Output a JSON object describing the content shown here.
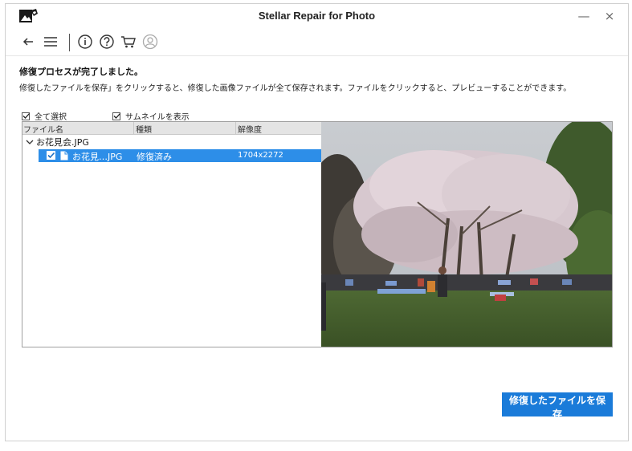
{
  "window": {
    "title": "Stellar Repair for Photo",
    "minimize_glyph": "—",
    "close_glyph": "×"
  },
  "toolbar": {
    "icons": [
      "back-arrow-icon",
      "menu-icon",
      "info-icon",
      "help-icon",
      "cart-icon",
      "account-icon"
    ]
  },
  "content": {
    "heading": "修復プロセスが完了しました。",
    "description": "修復したファイルを保存」をクリックすると、修復した画像ファイルが全て保存されます。ファイルをクリックすると、プレビューすることができます。",
    "select_all_label": "全て選択",
    "thumbnail_label": "サムネイルを表示"
  },
  "table": {
    "columns": [
      "ファイル名",
      "種類",
      "解像度"
    ],
    "group": {
      "name": "お花見会.JPG",
      "files": [
        {
          "name": "お花見…JPG",
          "type": "修復済み",
          "resolution": "1704x2272",
          "checked": true
        }
      ]
    }
  },
  "save_button": {
    "label": "修復したファイルを保存"
  },
  "colors": {
    "accent": "#1a7bd9",
    "selection": "#2d8ee8",
    "header_bg": "#e4e4e4"
  }
}
